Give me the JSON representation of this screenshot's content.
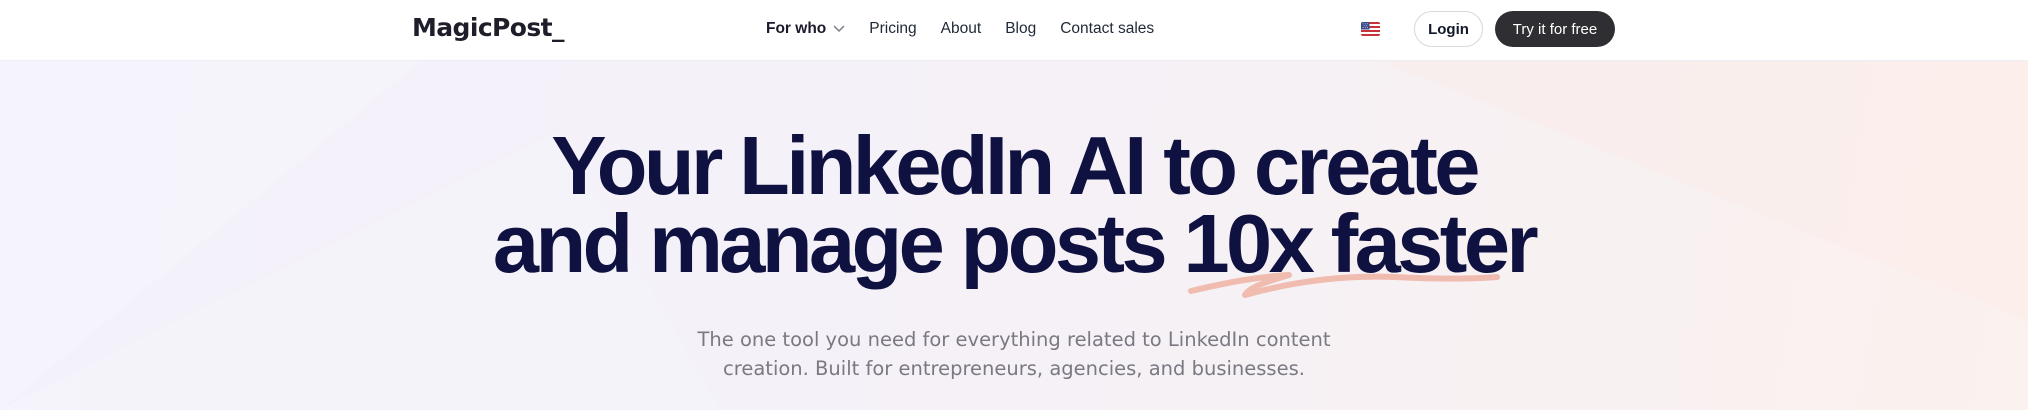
{
  "brand": {
    "name": "MagicPost_"
  },
  "nav": {
    "items": [
      {
        "label": "For who",
        "has_dropdown": true
      },
      {
        "label": "Pricing"
      },
      {
        "label": "About"
      },
      {
        "label": "Blog"
      },
      {
        "label": "Contact sales"
      }
    ]
  },
  "header": {
    "language_icon": "us-flag-icon",
    "login_label": "Login",
    "cta_label": "Try it for free"
  },
  "hero": {
    "headline_line1": "Your LinkedIn AI to create",
    "headline_line2_prefix": "and manage posts ",
    "headline_highlight": "10x faster",
    "subtitle_line1": "The one tool you need for everything related to LinkedIn content",
    "subtitle_line2": "creation. Built for entrepreneurs, agencies, and businesses."
  },
  "colors": {
    "headline": "#0f1140",
    "accent_underline": "#f0b6a8",
    "cta_background": "#2f2f33"
  }
}
